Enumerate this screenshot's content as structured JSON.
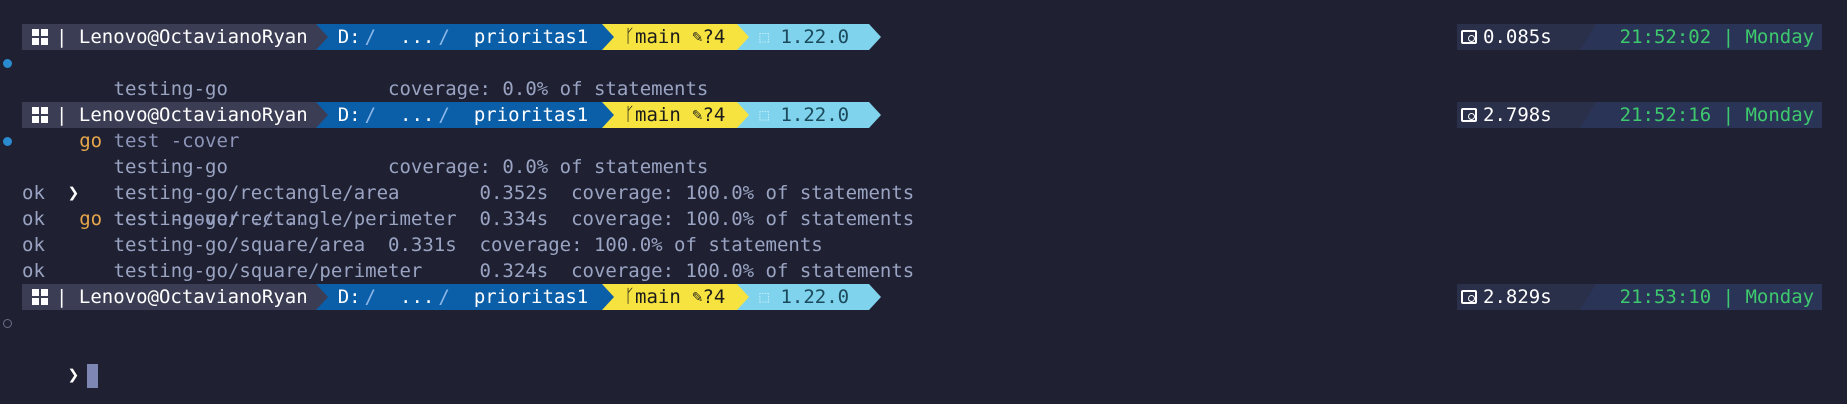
{
  "prompts": [
    {
      "user": "Lenovo@OctavianoRyan",
      "drive": "D:",
      "ellipsis": "...",
      "folder": "prioritas1",
      "branch": "main",
      "git_status": "?4",
      "lang_version": "1.22.0",
      "duration": "0.085s",
      "clock": "21:52:02 | Monday",
      "command_kw": "go",
      "command_rest": " test -cover",
      "status_dot": "filled"
    },
    {
      "user": "Lenovo@OctavianoRyan",
      "drive": "D:",
      "ellipsis": "...",
      "folder": "prioritas1",
      "branch": "main",
      "git_status": "?4",
      "lang_version": "1.22.0",
      "duration": "2.798s",
      "clock": "21:52:16 | Monday",
      "command_kw": "go",
      "command_rest": " test -cover ./...",
      "status_dot": "filled"
    },
    {
      "user": "Lenovo@OctavianoRyan",
      "drive": "D:",
      "ellipsis": "...",
      "folder": "prioritas1",
      "branch": "main",
      "git_status": "?4",
      "lang_version": "1.22.0",
      "duration": "2.829s",
      "clock": "21:53:10 | Monday",
      "status_dot": "hollow"
    }
  ],
  "outputs": {
    "first": [
      "        testing-go              coverage: 0.0% of statements"
    ],
    "second": [
      "        testing-go              coverage: 0.0% of statements",
      "ok      testing-go/rectangle/area       0.352s  coverage: 100.0% of statements",
      "ok      testing-go/rectangle/perimeter  0.334s  coverage: 100.0% of statements",
      "ok      testing-go/square/area  0.331s  coverage: 100.0% of statements",
      "ok      testing-go/square/perimeter     0.324s  coverage: 100.0% of statements"
    ]
  },
  "symbols": {
    "chevron": "❯",
    "separator": "|",
    "path_slash": "/",
    "branch_icon": "ᚴ",
    "pencil_icon": "✎",
    "pkg_icon": "⬚"
  },
  "colors": {
    "background": "#1f2133",
    "user_segment": "#3b3d54",
    "path_segment": "#0b5ea8",
    "git_segment": "#f6e33f",
    "lang_segment": "#7fd3ec",
    "clock_text": "#3ec96e",
    "go_keyword": "#e7a64a",
    "cursor": "#7e87b4"
  }
}
